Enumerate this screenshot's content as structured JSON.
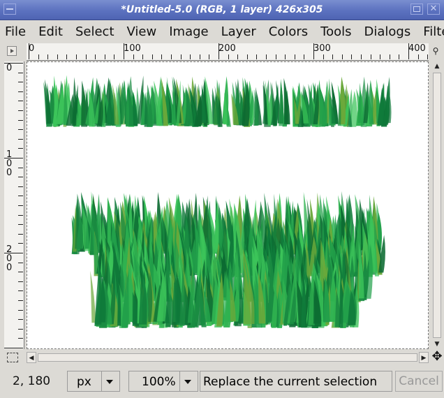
{
  "window": {
    "title": "*Untitled-5.0 (RGB, 1 layer) 426x305"
  },
  "menubar": {
    "items": [
      "File",
      "Edit",
      "Select",
      "View",
      "Image",
      "Layer",
      "Colors",
      "Tools",
      "Dialogs",
      "Filte"
    ]
  },
  "rulers": {
    "horizontal_labels": [
      "0",
      "100",
      "200",
      "300",
      "400"
    ],
    "vertical_labels": [
      "0",
      "100",
      "200"
    ]
  },
  "icons": {
    "menu": "window-menu-icon",
    "maximize": "maximize-icon",
    "close": "close-icon",
    "quickmask": "quickmask-icon",
    "navigate": "navigate-icon",
    "zoom": "zoom-icon"
  },
  "colors": {
    "titlebar": "#5b71bf",
    "grass_dark": "#0f7a3a",
    "grass_mid": "#22a04a",
    "grass_light": "#3cc45a"
  },
  "statusbar": {
    "coords": "2, 180",
    "unit": "px",
    "zoom": "100%",
    "message": "Replace the current selection",
    "cancel_label": "Cancel"
  }
}
